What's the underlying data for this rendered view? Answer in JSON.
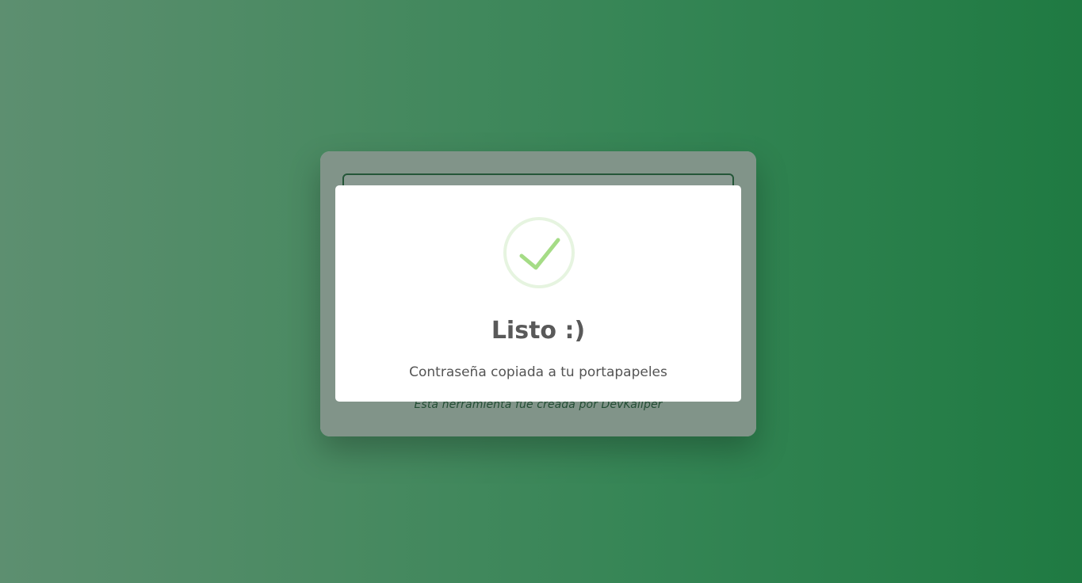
{
  "background_app": {
    "credit_text": "Esta herramienta fue creada por DevKaliper"
  },
  "modal": {
    "icon": "success-check-icon",
    "title": "Listo :)",
    "message": "Contraseña copiada a tu portapapeles",
    "colors": {
      "check": "#a5dc86",
      "ring": "#e6f4e0",
      "title": "#595959",
      "message": "#545454"
    }
  },
  "colors": {
    "background_left": "#5d8f70",
    "background_right": "#1f7a42",
    "field_border": "#1f6b3a"
  }
}
